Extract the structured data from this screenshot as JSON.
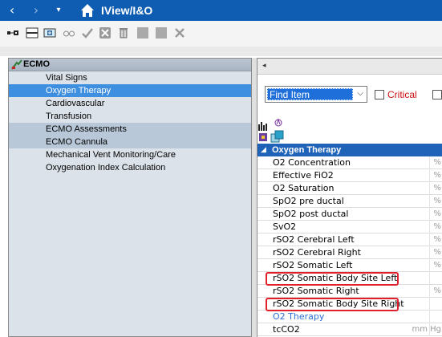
{
  "titlebar": {
    "back_glyph": "‹",
    "forward_glyph": "›",
    "dropdown_glyph": "▾",
    "title": "IView/I&O"
  },
  "toolbar": {
    "icons": [
      "connect-icon",
      "split-pane-icon",
      "plus-table-icon",
      "glasses-icon",
      "checkmark-icon",
      "cancel-icon",
      "trash-icon",
      "gray-square-icon",
      "gray-square-icon",
      "close-x-icon"
    ]
  },
  "left_panel": {
    "header": "ECMO",
    "items": [
      {
        "label": "Vital Signs",
        "state": "normal"
      },
      {
        "label": "Oxygen Therapy",
        "state": "selected"
      },
      {
        "label": "Cardiovascular",
        "state": "normal"
      },
      {
        "label": "Transfusion",
        "state": "normal"
      },
      {
        "label": "ECMO Assessments",
        "state": "dark"
      },
      {
        "label": "ECMO Cannula",
        "state": "dark"
      },
      {
        "label": "Mechanical Vent Monitoring/Care",
        "state": "normal"
      },
      {
        "label": "Oxygenation Index Calculation",
        "state": "normal"
      }
    ]
  },
  "right_panel": {
    "scroll_left_glyph": "◂",
    "find": {
      "value": "Find Item",
      "dropdown_glyph": "⌵"
    },
    "critical_label": "Critical",
    "section": {
      "expand_glyph": "◢",
      "title": "Oxygen Therapy"
    },
    "rows": [
      {
        "label": "O2 Concentration",
        "unit": "%"
      },
      {
        "label": "Effective FiO2",
        "unit": "%"
      },
      {
        "label": "O2 Saturation",
        "unit": "%"
      },
      {
        "label": "SpO2 pre ductal",
        "unit": "%"
      },
      {
        "label": "SpO2 post ductal",
        "unit": "%"
      },
      {
        "label": "SvO2",
        "unit": "%"
      },
      {
        "label": "rSO2 Cerebral Left",
        "unit": "%"
      },
      {
        "label": "rSO2 Cerebral Right",
        "unit": "%"
      },
      {
        "label": "rSO2 Somatic Left",
        "unit": "%"
      },
      {
        "label": "rSO2 Somatic Body Site Left",
        "unit": "",
        "highlighted": true
      },
      {
        "label": "rSO2 Somatic Right",
        "unit": "%"
      },
      {
        "label": "rSO2 Somatic Body Site Right",
        "unit": "",
        "highlighted": true
      },
      {
        "label": "O2 Therapy",
        "unit": "",
        "link": true
      },
      {
        "label": "tcCO2",
        "unit": "mm Hg"
      }
    ]
  },
  "colors": {
    "titlebar": "#0e5db2",
    "selection": "#3f8fe1",
    "section_header": "#1f63b8",
    "highlight_border": "#e0202a",
    "critical": "#cc1111"
  }
}
